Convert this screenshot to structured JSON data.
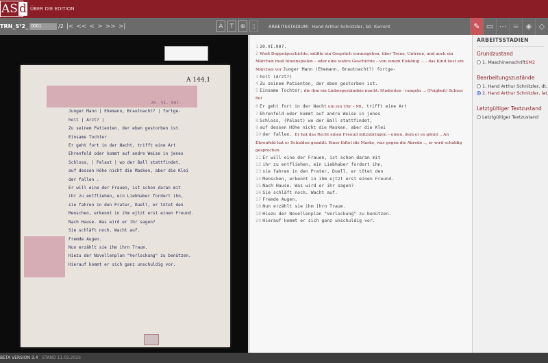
{
  "header": {
    "logo": "ASd",
    "about_link": "ÜBER DIE EDITION"
  },
  "toolbar": {
    "signature": "TRN_Sᵀ2_",
    "page_value": "0001",
    "page_total": "/2",
    "nav": [
      "|<",
      "<<",
      "<",
      ">",
      ">>",
      ">|"
    ],
    "tools": [
      "A",
      "T",
      "⊕",
      "▯"
    ],
    "stage_label": "ARBEITSSTADIUM:",
    "stage_value": "Hand Arthur Schnitzler, lat. Kurrent",
    "right_tools": [
      "edit-icon",
      "comment-icon",
      "comment-dots-icon",
      "comment-lines-icon",
      "tag-icon",
      "tag-outline-icon"
    ]
  },
  "facsimile": {
    "label": "A 144,1",
    "lines": [
      "20. VI. 907.",
      "Junger Mann | Ehemann, Brautnacht? | fortge-",
      "holt | Arzt? |",
      "Zu seinem Patienten, der eben gestorben ist.",
      "Einsame Tochter",
      "Er geht fort in der Nacht, trifft eine Art",
      "Ehrenfeld oder kommt auf andre Weise in jenes",
      "Schloss, | Palast | wo der Ball stattfindet,",
      "auf dessen Höhe nicht die Masken, aber die Klei",
      "der fallen .",
      "Er will eine der Frauen, ist schon daran mit",
      "ihr zu entfliehen, ein Liebhaber fordert ihn,",
      "sie fahren in den Prater, Duell, er tötet den",
      "Menschen, erkennt in ihm ejtzt erst einen Freund.",
      "Nach Hause. Was wird er ihr sagen?",
      "Sie schläft noch. Wacht auf.",
      "Fremde Augen.",
      "Nun erzählt sie ihm ihrn Traum.",
      "Hiezu der Novellenplan \"Verlockung\" zu benützen.",
      "Hierauf kommt er sich ganz unschuldig vor."
    ]
  },
  "transcript": [
    {
      "n": "1",
      "segs": [
        {
          "k": "t",
          "v": "20.VI.907."
        }
      ]
    },
    {
      "n": "2",
      "segs": [
        {
          "k": "h",
          "v": "Weiß Doppelgeschichte, müßte ein Gespräch vorausgehen, über Treue, Untreue, und auch ein Märchen muß hineinspielen – oder eine wahre Geschichte – von einem Eiskönig ..... das Kind liest ein Märchen vor "
        },
        {
          "k": "t",
          "v": "Junger Mann (Ehemann, Brautnacht?) fortge-"
        }
      ]
    },
    {
      "n": "3",
      "segs": [
        {
          "k": "t",
          "v": "holt (Arzt?)"
        }
      ]
    },
    {
      "n": "4",
      "segs": [
        {
          "k": "t",
          "v": "Zu seinem Patienten, der eben gestorben ist."
        }
      ]
    },
    {
      "n": "5",
      "segs": [
        {
          "k": "t",
          "v": "Einsame Tochter;"
        },
        {
          "k": "h",
          "v": " die ihm ein Liebesgeständnis macht. Studenten - rangeln ... (Feigheit) Schuss fiel"
        }
      ]
    },
    {
      "n": "6",
      "segs": [
        {
          "k": "t",
          "v": "Er geht fort in der Nacht"
        },
        {
          "k": "h",
          "v": " um ein Uhr – Ml"
        },
        {
          "k": "t",
          "v": ", trifft eine Art"
        }
      ]
    },
    {
      "n": "7",
      "segs": [
        {
          "k": "t",
          "v": "Ehrenfeld oder kommt auf andre Weise in jenes"
        }
      ]
    },
    {
      "n": "8",
      "segs": [
        {
          "k": "t",
          "v": "Schloss, (Palast) wo der Ball stattfindet,"
        }
      ]
    },
    {
      "n": "9",
      "segs": [
        {
          "k": "t",
          "v": "auf dessen Höhe nicht die Masken, aber die Klei"
        }
      ]
    },
    {
      "n": "10",
      "segs": [
        {
          "k": "t",
          "v": "der fallen. "
        },
        {
          "k": "h",
          "v": "Er hat das Recht einen Freund mitzubringen – einen, dem er es gönnt .. An Ehrenfeld hat er Schulden gezahlt. Einer lüftet die Maske, was gegen die Abrede .., er wird schuldig gesprochen"
        }
      ]
    },
    {
      "n": "11",
      "segs": [
        {
          "k": "t",
          "v": "Er will eine der Frauen, ist schon daran mit"
        }
      ]
    },
    {
      "n": "12",
      "segs": [
        {
          "k": "t",
          "v": "ihr zu entfliehen, ein Liebhaber fordert ihn,"
        }
      ]
    },
    {
      "n": "13",
      "segs": [
        {
          "k": "t",
          "v": "sie fahren in den Prater, Duell, er tötet den"
        }
      ]
    },
    {
      "n": "14",
      "segs": [
        {
          "k": "t",
          "v": "Menschen, erkennt in ihm ejtzt erst einen Freund."
        }
      ]
    },
    {
      "n": "15",
      "segs": [
        {
          "k": "t",
          "v": "Nach Hause. Was wird er ihr sagen?"
        }
      ]
    },
    {
      "n": "16",
      "segs": [
        {
          "k": "t",
          "v": "Sie schläft noch. Wacht auf."
        }
      ]
    },
    {
      "n": "17",
      "segs": [
        {
          "k": "t",
          "v": "Fremde Augen."
        }
      ]
    },
    {
      "n": "18",
      "segs": [
        {
          "k": "t",
          "v": "Nun erzählt sie ihm ihrn Traum."
        }
      ]
    },
    {
      "n": "19",
      "segs": [
        {
          "k": "t",
          "v": "Hiezu der Novellenplan \"Verlockung\" zu benützen."
        }
      ]
    },
    {
      "n": "20",
      "segs": [
        {
          "k": "t",
          "v": "Hierauf kommt er sich ganz unschuldig vor."
        }
      ]
    }
  ],
  "sidebar": {
    "title": "ARBEITSSTADIEN",
    "groups": [
      {
        "title": "Grundzustand",
        "options": [
          {
            "label": "1. Maschinenschrift ",
            "extra": "SM2",
            "selected": false
          }
        ]
      },
      {
        "title": "Bearbeitungszustände",
        "options": [
          {
            "label": "1. Hand Arthur Schnitzler, dt. Kurrent",
            "selected": false
          },
          {
            "label": "2. Hand Arthur Schnitzler, lat. Kurrent",
            "selected": true
          }
        ]
      },
      {
        "title": "Letztgültiger Textzustand",
        "options": [
          {
            "label": "Letztgültiger Textzustand",
            "selected": false
          }
        ]
      }
    ]
  },
  "footer": {
    "version": "BETA VERSION 3.4",
    "date": "STAND 11.02.2026"
  },
  "colors": {
    "brand": "#8a1d25",
    "active_tool": "#c9545a"
  }
}
